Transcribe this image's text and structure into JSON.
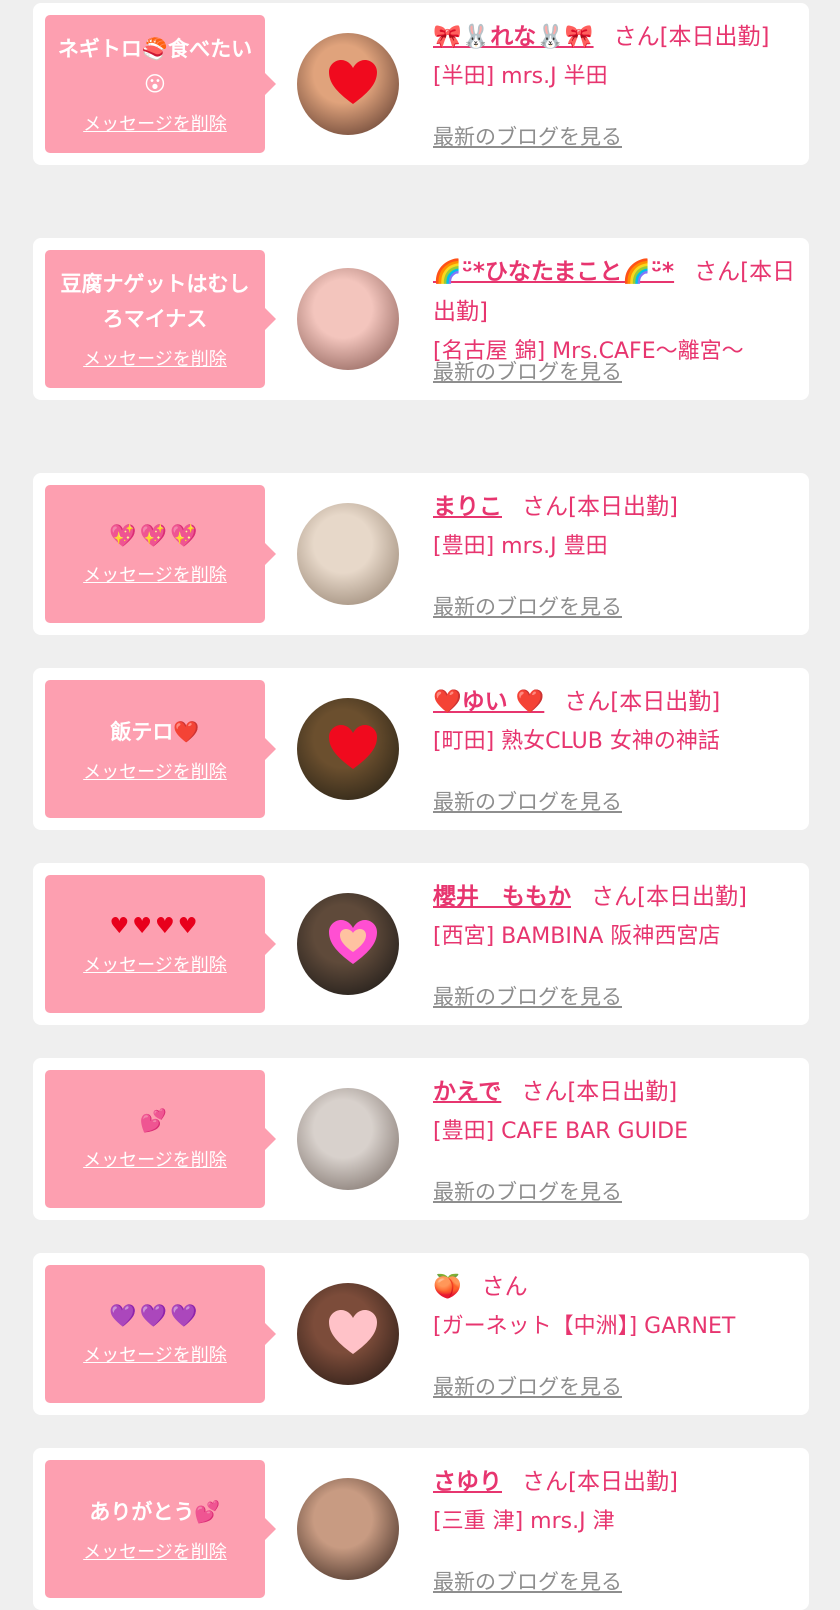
{
  "messages": [
    {
      "message": "ネギトロ🍣食べたい😮",
      "delete_label": "メッセージを削除",
      "name": "🎀🐰れな🐰🎀",
      "name_suffix": "さん[本日出勤]",
      "shop": "[半田] mrs.J 半田",
      "blog_label": "最新のブログを見る",
      "avatar_colors": [
        "#e0a37c",
        "#4a2c24"
      ]
    },
    {
      "message": "豆腐ナゲットはむしろマイナス",
      "delete_label": "メッセージを削除",
      "name": "🌈ᵕ̈*ひなたまこと🌈ᵕ̈*",
      "name_suffix": "さん[本日出勤]",
      "shop": "[名古屋 錦] Mrs.CAFE～離宮～",
      "blog_label": "最新のブログを見る",
      "avatar_colors": [
        "#f3c5bd",
        "#7a4e46"
      ]
    },
    {
      "message": "💖💖💖",
      "delete_label": "メッセージを削除",
      "name": "まりこ",
      "name_suffix": "さん[本日出勤]",
      "shop": "[豊田] mrs.J 豊田",
      "blog_label": "最新のブログを見る",
      "avatar_colors": [
        "#e7d8c9",
        "#8a7765"
      ]
    },
    {
      "message": "飯テロ❤️",
      "delete_label": "メッセージを削除",
      "name": "❤️ゆい ❤️",
      "name_suffix": "さん[本日出勤]",
      "shop": "[町田] 熟女CLUB 女神の神話",
      "blog_label": "最新のブログを見る",
      "avatar_colors": [
        "#6b4f2e",
        "#1c1a12"
      ]
    },
    {
      "message": "♥♥♥♥",
      "delete_label": "メッセージを削除",
      "name": "櫻井　ももか",
      "name_suffix": "さん[本日出勤]",
      "shop": "[西宮] BAMBINA 阪神西宮店",
      "blog_label": "最新のブログを見る",
      "avatar_colors": [
        "#5f4a3a",
        "#121212"
      ]
    },
    {
      "message": "💕",
      "delete_label": "メッセージを削除",
      "name": "かえで",
      "name_suffix": "さん[本日出勤]",
      "shop": "[豊田] CAFE BAR GUIDE",
      "blog_label": "最新のブログを見る",
      "avatar_colors": [
        "#d8d1cc",
        "#6e615a"
      ]
    },
    {
      "message": "💜💜💜",
      "delete_label": "メッセージを削除",
      "name": "🍑",
      "name_suffix": "さん",
      "shop": "[ガーネット【中洲】] GARNET",
      "blog_label": "最新のブログを見る",
      "avatar_colors": [
        "#7c4c3a",
        "#1c1410"
      ]
    },
    {
      "message": "ありがとう💕",
      "delete_label": "メッセージを削除",
      "name": "さゆり",
      "name_suffix": "さん[本日出勤]",
      "shop": "[三重 津] mrs.J 津",
      "blog_label": "最新のブログを見る",
      "avatar_colors": [
        "#c89b82",
        "#2a1a14"
      ]
    }
  ]
}
